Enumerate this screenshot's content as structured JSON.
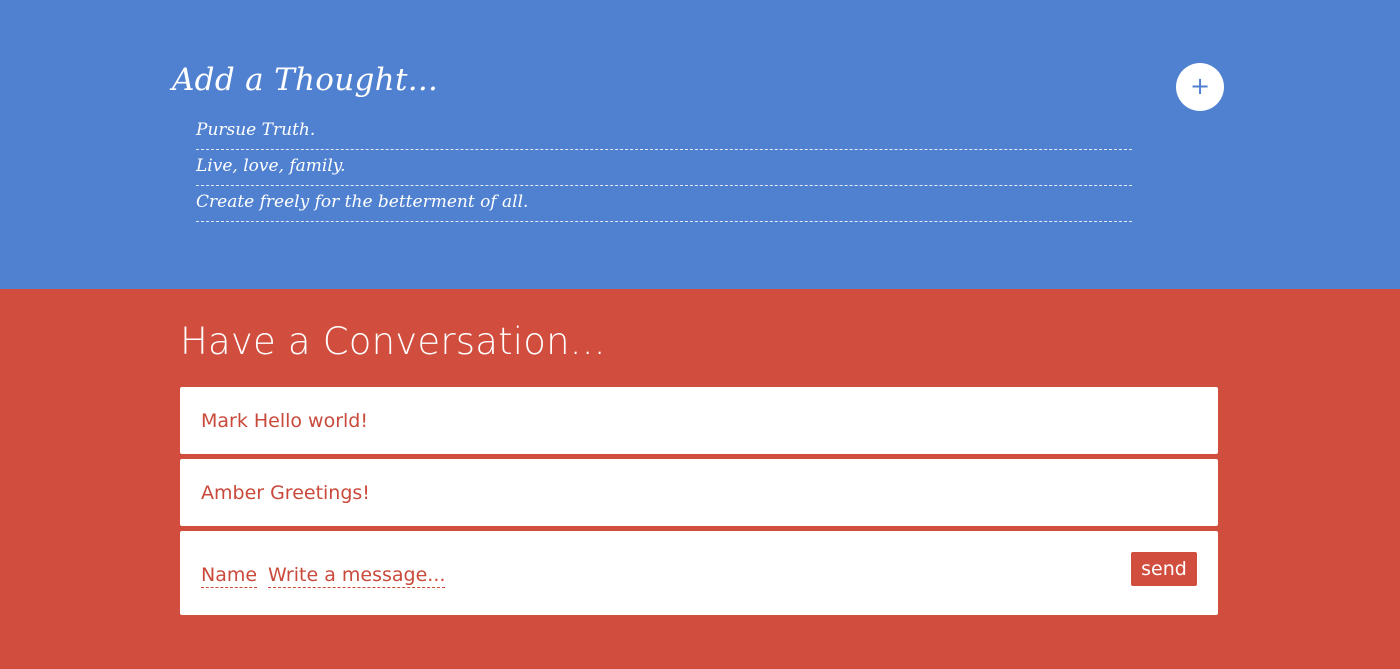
{
  "thoughts": {
    "title": "Add a Thought...",
    "add_button_label": "+",
    "items": [
      {
        "text": "Pursue Truth."
      },
      {
        "text": "Live, love, family."
      },
      {
        "text": "Create freely for the betterment of all."
      }
    ]
  },
  "conversation": {
    "title": "Have a Conversation...",
    "messages": [
      {
        "author": "Mark",
        "text": "Hello world!"
      },
      {
        "author": "Amber",
        "text": "Greetings!"
      }
    ],
    "composer": {
      "name_placeholder": "Name",
      "message_placeholder": "Write a message...",
      "send_label": "send"
    }
  },
  "colors": {
    "thought_bg": "#5081d0",
    "conversation_bg": "#d14e3f",
    "accent_text": "#c9493b",
    "white": "#ffffff"
  }
}
